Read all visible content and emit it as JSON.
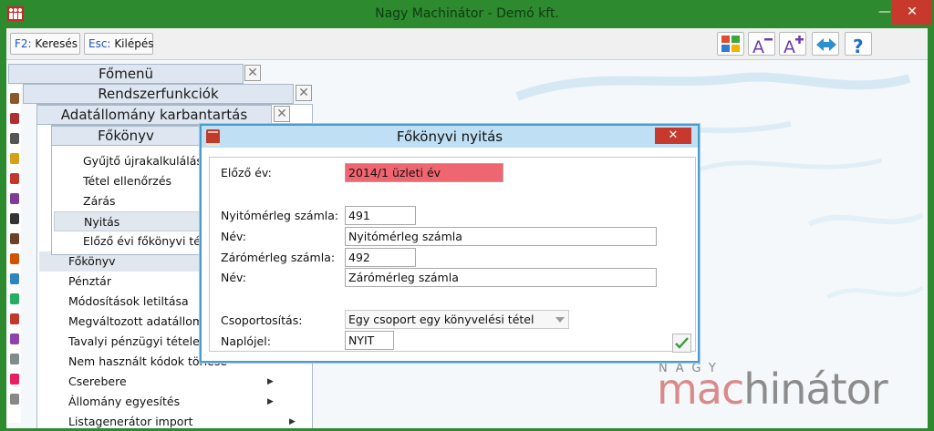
{
  "window": {
    "title": "Nagy Machinátor - Demó kft.",
    "minimize": "—",
    "close": "✕"
  },
  "toolbar": {
    "search_key": "F2:",
    "search_label": "Keresés",
    "exit_key": "Esc:",
    "exit_label": "Kilépés",
    "icons": [
      "grid-colors-icon",
      "font-decrease-icon",
      "font-increase-icon",
      "swap-arrows-icon",
      "help-icon"
    ]
  },
  "menus": {
    "main_title": "Főmenü",
    "system_title": "Rendszerfunkciók",
    "maintenance_title": "Adatállomány karbantartás",
    "ledger_title": "Főkönyv",
    "ledger_items": [
      "Gyűjtő újrakalkulálás",
      "Tétel ellenőrzés",
      "Zárás",
      "Nyitás",
      "Előző évi főkönyvi té"
    ],
    "maintenance_items": [
      "Főkönyv",
      "Pénztár",
      "Módosítások letiltása",
      "Megváltozott adatállom",
      "Tavalyi pénzügyi tételel",
      "Nem használt kódok törlése",
      "Cserebere",
      "Állomány egyesítés",
      "Listagenerátor import"
    ]
  },
  "dialog": {
    "title": "Főkönyvi nyitás",
    "close": "✕",
    "prev_year_label": "Előző év:",
    "prev_year_value": "2014/1 üzleti év",
    "opening_account_label": "Nyitómérleg számla:",
    "opening_account_value": "491",
    "opening_name_label": "Név:",
    "opening_name_value": "Nyitómérleg számla",
    "closing_account_label": "Zárómérleg számla:",
    "closing_account_value": "492",
    "closing_name_label": "Név:",
    "closing_name_value": "Zárómérleg számla",
    "grouping_label": "Csoportosítás:",
    "grouping_value": "Egy csoport egy könyvelési tétel",
    "journal_label": "Naplójel:",
    "journal_value": "NYIT"
  },
  "brand": {
    "top": "NAGY",
    "main_pink": "mac",
    "main_gray": "hinátor"
  },
  "colors": {
    "titlebar": "#2d8a2e",
    "highlight_field": "#f06670",
    "dialog_border": "#4b9bcf",
    "close_red": "#c7392c"
  }
}
